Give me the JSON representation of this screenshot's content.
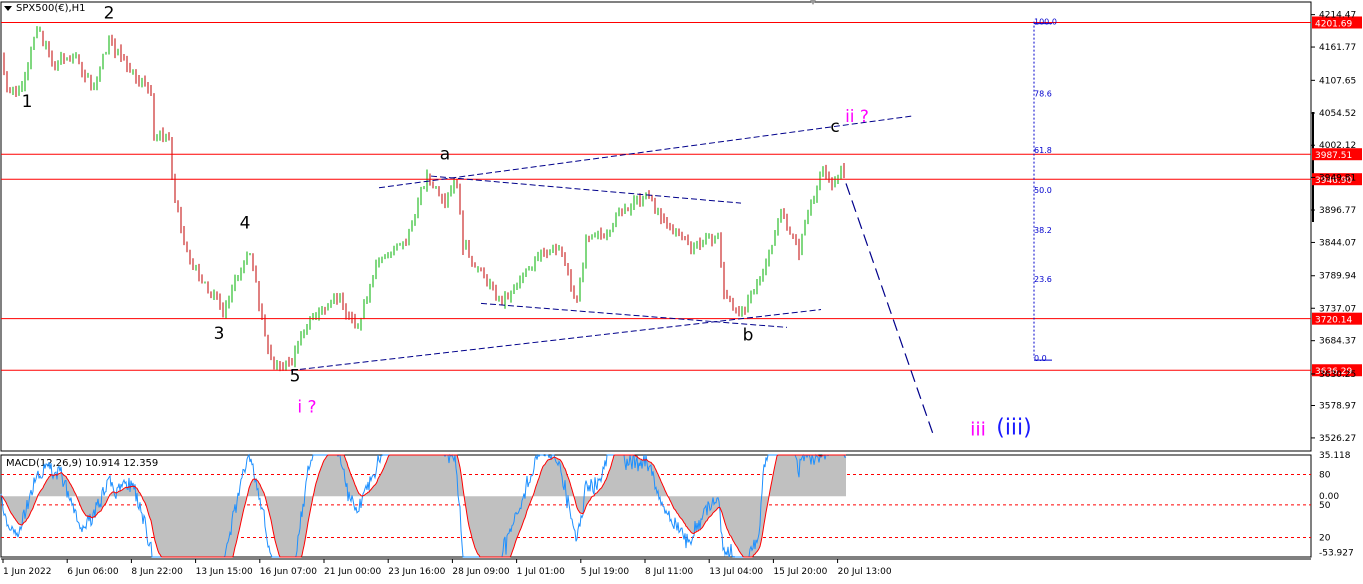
{
  "header": {
    "symbol_label": "SPX500(€),H1",
    "macd_label": "MACD(12,26,9) 10.914 12.359"
  },
  "colors": {
    "background": "#ffffff",
    "grid_border": "#000000",
    "bull_candle": "#00b000",
    "bear_candle": "#c00000",
    "level_line": "#ff0000",
    "trend_line": "#00008b",
    "fib_line": "#0000cd",
    "wave_black": "#000000",
    "wave_magenta": "#ff00ff",
    "wave_blue": "#1a1aff",
    "macd_line": "#1e90ff",
    "signal_line": "#ff0000",
    "histogram": "#c0c0c0",
    "price_tag_bg": "#ff0000",
    "price_tag_text": "#ffffff"
  },
  "chart_data": {
    "type": "candlestick",
    "symbol": "SPX500(€)",
    "timeframe": "H1",
    "x_axis_labels": [
      "1 Jun 2022",
      "6 Jun 06:00",
      "8 Jun 22:00",
      "13 Jun 15:00",
      "16 Jun 07:00",
      "21 Jun 00:00",
      "23 Jun 16:00",
      "28 Jun 09:00",
      "1 Jul 01:00",
      "5 Jul 19:00",
      "8 Jul 11:00",
      "13 Jul 04:00",
      "15 Jul 20:00",
      "20 Jul 13:00"
    ],
    "price_axis_ticks": [
      "4214.47",
      "4161.77",
      "4107.65",
      "4054.52",
      "4002.12",
      "3949.81",
      "3896.77",
      "3844.07",
      "3789.94",
      "3737.07",
      "3684.37",
      "3630.25",
      "3578.97",
      "3526.27"
    ],
    "price_range": [
      3505,
      4235
    ],
    "horizontal_levels": [
      {
        "label": "4201.69",
        "value": 4201.69
      },
      {
        "label": "3987.51",
        "value": 3987.51
      },
      {
        "label": "3946.90",
        "value": 3946.9
      },
      {
        "label": "3720.14",
        "value": 3720.14
      },
      {
        "label": "3636.29",
        "value": 3636.29
      }
    ],
    "fibonacci": [
      {
        "label": "100.0",
        "value": 4203
      },
      {
        "label": "78.6",
        "value": 4086
      },
      {
        "label": "61.8",
        "value": 3994
      },
      {
        "label": "50.0",
        "value": 3929
      },
      {
        "label": "38.2",
        "value": 3864
      },
      {
        "label": "23.6",
        "value": 3785
      },
      {
        "label": "0.0",
        "value": 3656
      }
    ],
    "path": [
      {
        "t": 0,
        "p": 4150
      },
      {
        "t": 7,
        "p": 4095
      },
      {
        "t": 18,
        "p": 4090
      },
      {
        "t": 37,
        "p": 4192
      },
      {
        "t": 52,
        "p": 4130
      },
      {
        "t": 72,
        "p": 4150
      },
      {
        "t": 92,
        "p": 4095
      },
      {
        "t": 108,
        "p": 4172
      },
      {
        "t": 130,
        "p": 4125
      },
      {
        "t": 150,
        "p": 4090
      },
      {
        "t": 152,
        "p": 4020
      },
      {
        "t": 168,
        "p": 4015
      },
      {
        "t": 173,
        "p": 3915
      },
      {
        "t": 185,
        "p": 3830
      },
      {
        "t": 200,
        "p": 3780
      },
      {
        "t": 222,
        "p": 3735
      },
      {
        "t": 248,
        "p": 3835
      },
      {
        "t": 262,
        "p": 3710
      },
      {
        "t": 272,
        "p": 3640
      },
      {
        "t": 290,
        "p": 3650
      },
      {
        "t": 305,
        "p": 3710
      },
      {
        "t": 335,
        "p": 3760
      },
      {
        "t": 355,
        "p": 3700
      },
      {
        "t": 375,
        "p": 3810
      },
      {
        "t": 405,
        "p": 3845
      },
      {
        "t": 425,
        "p": 3950
      },
      {
        "t": 445,
        "p": 3915
      },
      {
        "t": 455,
        "p": 3955
      },
      {
        "t": 462,
        "p": 3840
      },
      {
        "t": 500,
        "p": 3745
      },
      {
        "t": 518,
        "p": 3775
      },
      {
        "t": 540,
        "p": 3835
      },
      {
        "t": 560,
        "p": 3830
      },
      {
        "t": 575,
        "p": 3740
      },
      {
        "t": 585,
        "p": 3845
      },
      {
        "t": 605,
        "p": 3860
      },
      {
        "t": 622,
        "p": 3900
      },
      {
        "t": 648,
        "p": 3920
      },
      {
        "t": 660,
        "p": 3880
      },
      {
        "t": 690,
        "p": 3840
      },
      {
        "t": 718,
        "p": 3855
      },
      {
        "t": 722,
        "p": 3760
      },
      {
        "t": 742,
        "p": 3725
      },
      {
        "t": 760,
        "p": 3790
      },
      {
        "t": 780,
        "p": 3895
      },
      {
        "t": 798,
        "p": 3830
      },
      {
        "t": 808,
        "p": 3905
      },
      {
        "t": 822,
        "p": 3960
      },
      {
        "t": 836,
        "p": 3935
      },
      {
        "t": 840,
        "p": 3975
      },
      {
        "t": 845,
        "p": 3940
      }
    ],
    "trend_lines": [
      {
        "from": {
          "t": 378,
          "p": 3933
        },
        "to": {
          "t": 913,
          "p": 4050
        }
      },
      {
        "from": {
          "t": 290,
          "p": 3636
        },
        "to": {
          "t": 820,
          "p": 3735
        }
      },
      {
        "from": {
          "t": 430,
          "p": 3952
        },
        "to": {
          "t": 740,
          "p": 3908
        }
      },
      {
        "from": {
          "t": 480,
          "p": 3745
        },
        "to": {
          "t": 786,
          "p": 3706
        }
      }
    ],
    "projection": {
      "from": {
        "t": 845,
        "p": 3940
      },
      "to": {
        "t": 933,
        "p": 3528
      }
    },
    "wave_labels": [
      {
        "text": "1",
        "t": 26,
        "p": 4064,
        "color": "wave_black",
        "size": 17
      },
      {
        "text": "2",
        "t": 108,
        "p": 4208,
        "color": "wave_black",
        "size": 17
      },
      {
        "text": "3",
        "t": 218,
        "p": 3687,
        "color": "wave_black",
        "size": 17
      },
      {
        "text": "4",
        "t": 244,
        "p": 3867,
        "color": "wave_black",
        "size": 17
      },
      {
        "text": "5",
        "t": 294,
        "p": 3618,
        "color": "wave_black",
        "size": 17
      },
      {
        "text": "i ?",
        "t": 306,
        "p": 3568,
        "color": "wave_magenta",
        "size": 17
      },
      {
        "text": "a",
        "t": 444,
        "p": 3979,
        "color": "wave_black",
        "size": 17
      },
      {
        "text": "b",
        "t": 747,
        "p": 3685,
        "color": "wave_black",
        "size": 17
      },
      {
        "text": "c",
        "t": 834,
        "p": 4024,
        "color": "wave_black",
        "size": 17
      },
      {
        "text": "ii ?",
        "t": 856,
        "p": 4040,
        "color": "wave_magenta",
        "size": 17
      },
      {
        "text": "iii",
        "t": 977,
        "p": 3530,
        "color": "wave_magenta",
        "size": 19
      },
      {
        "text": "(iii)",
        "t": 1013,
        "p": 3532,
        "color": "wave_blue",
        "size": 22
      }
    ],
    "macd": {
      "fast": 12,
      "slow": 26,
      "signal": 9,
      "value": 10.914,
      "signal_value": 12.359,
      "axis_ticks": [
        "35.118",
        "80",
        "0.00",
        "50",
        "20",
        "-53.927"
      ],
      "range": [
        -56,
        38
      ],
      "levels": [
        20,
        -8,
        -38
      ]
    }
  }
}
